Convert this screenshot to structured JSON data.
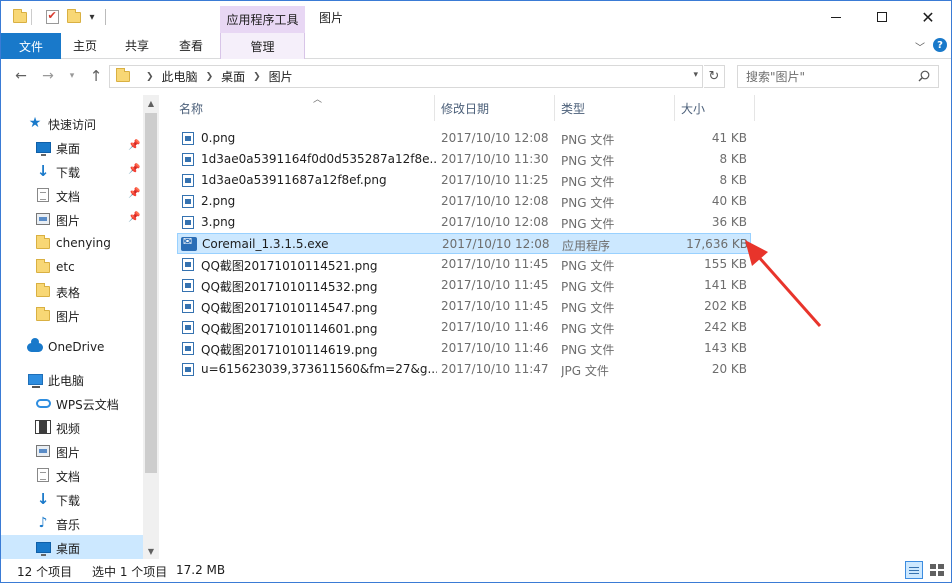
{
  "titlebar": {
    "context_tab": "应用程序工具",
    "window_title": "图片",
    "minimize": "—",
    "maximize": "□",
    "close": "✕"
  },
  "ribbon": {
    "tabs": [
      "文件",
      "主页",
      "共享",
      "查看",
      "管理"
    ],
    "accent_color": "#1979ca",
    "context_color": "#e8d7f4"
  },
  "address": {
    "crumbs": [
      "此电脑",
      "桌面",
      "图片"
    ],
    "search_placeholder": "搜索\"图片\""
  },
  "navpane": {
    "items": [
      {
        "label": "快速访问",
        "icon": "star-icon",
        "pinned": false
      },
      {
        "label": "桌面",
        "icon": "desktop-icon",
        "pinned": true
      },
      {
        "label": "下载",
        "icon": "download-icon",
        "pinned": true
      },
      {
        "label": "文档",
        "icon": "document-icon",
        "pinned": true
      },
      {
        "label": "图片",
        "icon": "pictures-icon",
        "pinned": true
      },
      {
        "label": "chenying",
        "icon": "folder-icon",
        "pinned": false
      },
      {
        "label": "etc",
        "icon": "folder-icon",
        "pinned": false
      },
      {
        "label": "表格",
        "icon": "folder-icon",
        "pinned": false
      },
      {
        "label": "图片",
        "icon": "folder-icon",
        "pinned": false
      },
      {
        "label": "OneDrive",
        "icon": "cloud-icon",
        "pinned": false
      },
      {
        "label": "此电脑",
        "icon": "computer-icon",
        "pinned": false
      },
      {
        "label": "WPS云文档",
        "icon": "wps-cloud-icon",
        "pinned": false
      },
      {
        "label": "视频",
        "icon": "video-icon",
        "pinned": false
      },
      {
        "label": "图片",
        "icon": "pictures-icon",
        "pinned": false
      },
      {
        "label": "文档",
        "icon": "document-icon",
        "pinned": false
      },
      {
        "label": "下载",
        "icon": "download-icon",
        "pinned": false
      },
      {
        "label": "音乐",
        "icon": "music-icon",
        "pinned": false
      },
      {
        "label": "桌面",
        "icon": "desktop-icon",
        "pinned": false
      }
    ]
  },
  "filelist": {
    "columns": {
      "name": "名称",
      "date": "修改日期",
      "type": "类型",
      "size": "大小"
    },
    "rows": [
      {
        "name": "0.png",
        "date": "2017/10/10 12:08",
        "type": "PNG 文件",
        "size": "41 KB"
      },
      {
        "name": "1d3ae0a5391164f0d0d535287a12f8e...",
        "date": "2017/10/10 11:30",
        "type": "PNG 文件",
        "size": "8 KB"
      },
      {
        "name": "1d3ae0a53911687a12f8ef.png",
        "date": "2017/10/10 11:25",
        "type": "PNG 文件",
        "size": "8 KB"
      },
      {
        "name": "2.png",
        "date": "2017/10/10 12:08",
        "type": "PNG 文件",
        "size": "40 KB"
      },
      {
        "name": "3.png",
        "date": "2017/10/10 12:08",
        "type": "PNG 文件",
        "size": "36 KB"
      },
      {
        "name": "Coremail_1.3.1.5.exe",
        "date": "2017/10/10 12:08",
        "type": "应用程序",
        "size": "17,636 KB"
      },
      {
        "name": "QQ截图20171010114521.png",
        "date": "2017/10/10 11:45",
        "type": "PNG 文件",
        "size": "155 KB"
      },
      {
        "name": "QQ截图20171010114532.png",
        "date": "2017/10/10 11:45",
        "type": "PNG 文件",
        "size": "141 KB"
      },
      {
        "name": "QQ截图20171010114547.png",
        "date": "2017/10/10 11:45",
        "type": "PNG 文件",
        "size": "202 KB"
      },
      {
        "name": "QQ截图20171010114601.png",
        "date": "2017/10/10 11:46",
        "type": "PNG 文件",
        "size": "242 KB"
      },
      {
        "name": "QQ截图20171010114619.png",
        "date": "2017/10/10 11:46",
        "type": "PNG 文件",
        "size": "143 KB"
      },
      {
        "name": "u=615623039,373611560&fm=27&g...",
        "date": "2017/10/10 11:47",
        "type": "JPG 文件",
        "size": "20 KB"
      }
    ]
  },
  "status": {
    "count": "12 个项目",
    "selected": "选中 1 个项目",
    "size": "17.2 MB"
  }
}
